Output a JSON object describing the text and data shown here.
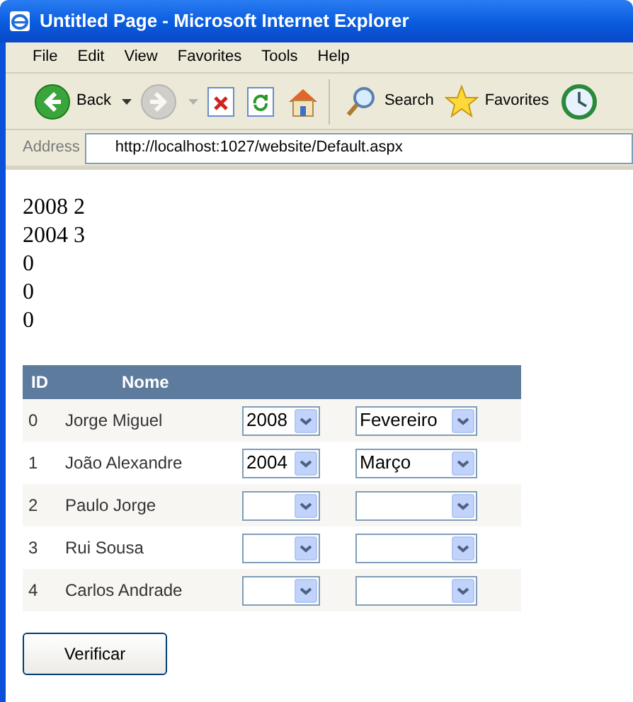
{
  "window": {
    "title": "Untitled Page - Microsoft Internet Explorer"
  },
  "menu": [
    "File",
    "Edit",
    "View",
    "Favorites",
    "Tools",
    "Help"
  ],
  "toolbar": [
    {
      "label": "Back",
      "disabled": false,
      "dropdown": true
    },
    {
      "disabled": true,
      "dropdown": true
    },
    {
      "disabled": false
    },
    {
      "disabled": false
    },
    {
      "disabled": false
    },
    {
      "label": "Search",
      "disabled": false,
      "separator_before": true
    },
    {
      "label": "Favorites",
      "disabled": false
    },
    {
      "disabled": false
    }
  ],
  "address": {
    "label": "Address",
    "url": "http://localhost:1027/website/Default.aspx"
  },
  "output_lines": [
    "2008 2",
    "2004 3",
    "0",
    "0",
    "0"
  ],
  "table": {
    "columns": [
      "ID",
      "Nome"
    ],
    "rows": [
      {
        "id": "0",
        "name": "Jorge Miguel",
        "year": "2008",
        "month": "Fevereiro"
      },
      {
        "id": "1",
        "name": "João Alexandre",
        "year": "2004",
        "month": "Março"
      },
      {
        "id": "2",
        "name": "Paulo Jorge"
      },
      {
        "id": "3",
        "name": "Rui Sousa"
      },
      {
        "id": "4",
        "name": "Carlos Andrade"
      }
    ]
  },
  "button": "Verificar"
}
